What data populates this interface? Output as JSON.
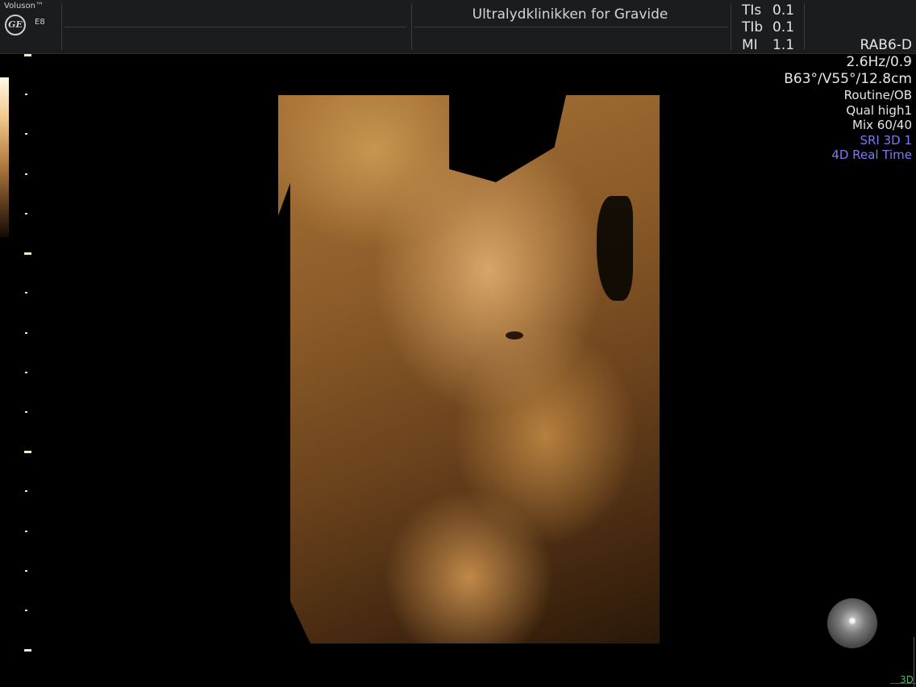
{
  "header": {
    "brand": "Voluson™",
    "logo_text": "GE",
    "model": "E8",
    "clinic": "Ultralydklinikken for Gravide",
    "indices": [
      {
        "label": "TIs",
        "value": "0.1"
      },
      {
        "label": "TIb",
        "value": "0.1"
      },
      {
        "label": "MI",
        "value": "1.1"
      }
    ]
  },
  "params": {
    "probe": "RAB6-D",
    "frequency": "2.6Hz/0.9",
    "angles": "B63°/V55°/12.8cm",
    "preset": "Routine/OB",
    "quality": "Qual high1",
    "mix": "Mix 60/40",
    "sri": "SRI 3D 1",
    "mode": "4D Real Time"
  },
  "corner": {
    "mode": "3D"
  },
  "icons": {
    "logo": "ge-logo-icon",
    "orientation": "orientation-sphere-icon"
  },
  "colors": {
    "accent_blue": "#7a7cf0",
    "sepia": "#c08a4a",
    "corner_green": "#3fbf5f"
  }
}
